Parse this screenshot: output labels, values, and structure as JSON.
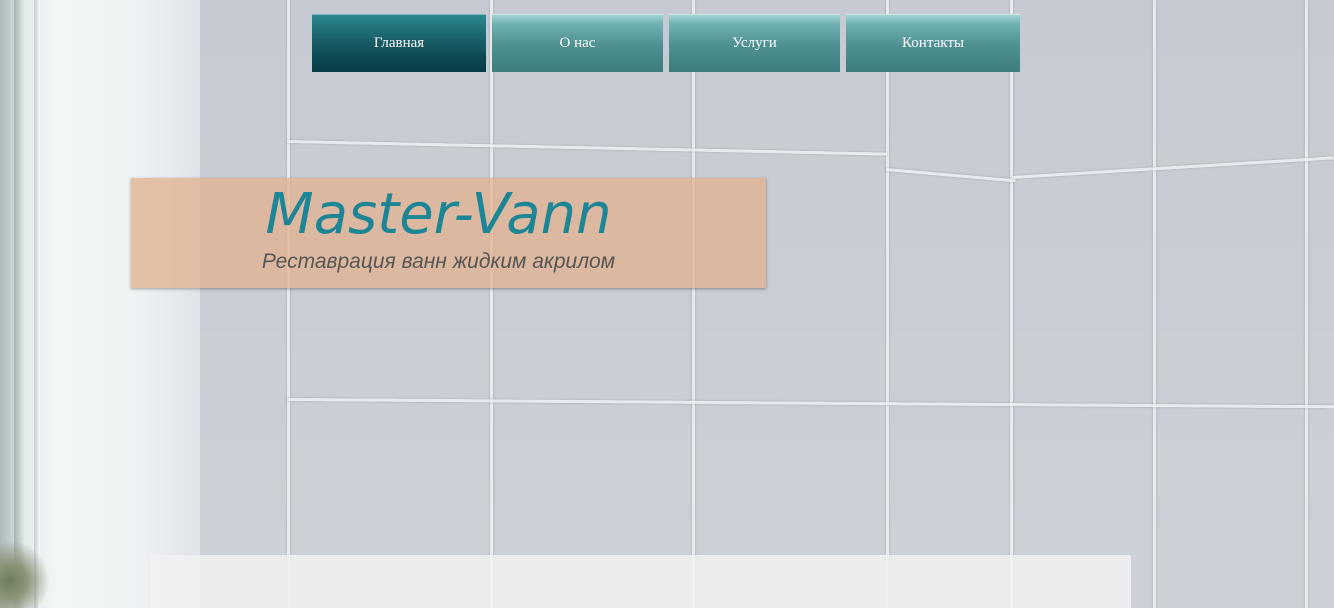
{
  "nav": {
    "items": [
      {
        "label": "Главная",
        "active": true
      },
      {
        "label": "О нас",
        "active": false
      },
      {
        "label": "Услуги",
        "active": false
      },
      {
        "label": "Контакты",
        "active": false
      }
    ]
  },
  "header": {
    "title": "Master-Vann",
    "subtitle": "Реставрация ванн жидким акрилом"
  },
  "colors": {
    "nav_active": "#0f4c55",
    "nav_inactive": "#4e9090",
    "title": "#1c8596",
    "subtitle": "#565656",
    "banner_bg": "#e2b291"
  }
}
